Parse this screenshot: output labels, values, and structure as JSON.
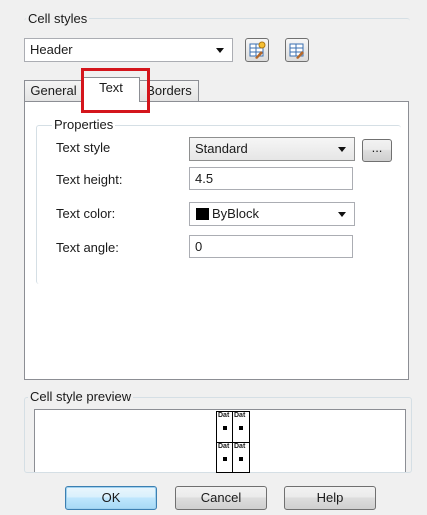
{
  "cell_styles": {
    "group_label": "Cell styles",
    "selected": "Header"
  },
  "tabs": [
    {
      "label": "General"
    },
    {
      "label": "Text"
    },
    {
      "label": "Borders"
    }
  ],
  "properties": {
    "group_label": "Properties",
    "text_style_label": "Text style",
    "text_style_value": "Standard",
    "ellipsis_label": "...",
    "text_height_label": "Text height:",
    "text_height_value": "4.5",
    "text_color_label": "Text color:",
    "text_color_value": "ByBlock",
    "text_color_swatch": "#000000",
    "text_angle_label": "Text angle:",
    "text_angle_value": "0"
  },
  "preview": {
    "group_label": "Cell style preview",
    "cell_text": "Dat"
  },
  "buttons": {
    "ok": "OK",
    "cancel": "Cancel",
    "help": "Help"
  },
  "colors": {
    "highlight": "#d4151c",
    "default_button": "#3c7fb1"
  },
  "icons": {
    "new_style": "new-table-style-icon",
    "modify_style": "modify-table-style-icon"
  }
}
